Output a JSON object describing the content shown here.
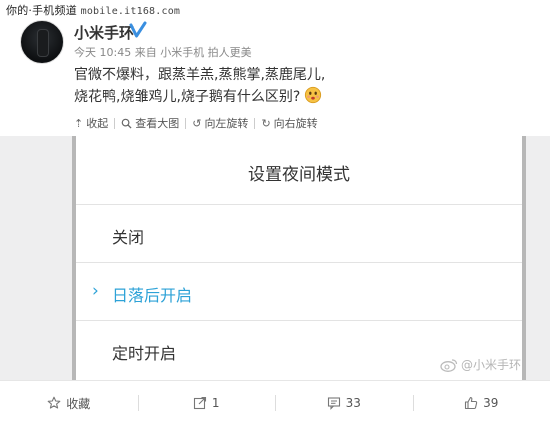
{
  "watermark": {
    "text": "你的·手机频道",
    "site": "mobile.it168.com"
  },
  "post": {
    "username": "小米手环",
    "meta": "今天 10:45 来自 小米手机 拍人更美",
    "text_line1": "官微不爆料，跟蒸羊羔,蒸熊掌,蒸鹿尾儿,",
    "text_line2": "烧花鸭,烧雏鸡儿,烧子鹅有什么区别?"
  },
  "image_toolbar": {
    "collapse": "收起",
    "view_large": "查看大图",
    "rotate_left": "向左旋转",
    "rotate_right": "向右旋转"
  },
  "screenshot": {
    "dialog_title": "设置夜间模式",
    "options": [
      "关闭",
      "日落后开启",
      "定时开启"
    ],
    "selected_index": 1,
    "watermark": "@小米手环",
    "accent_color": "#2da2d7"
  },
  "actions": {
    "favorite": "收藏",
    "repost": "1",
    "comments": "33",
    "likes": "39"
  }
}
